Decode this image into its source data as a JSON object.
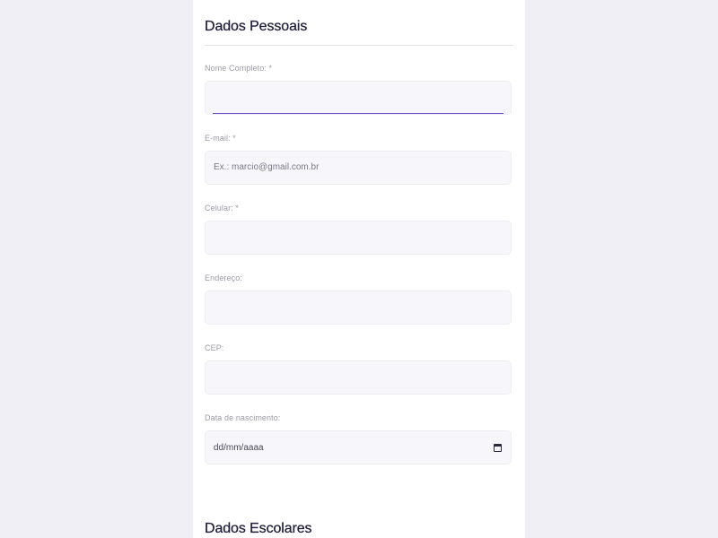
{
  "personal": {
    "title": "Dados Pessoais",
    "fields": {
      "full_name": {
        "label": "Nome Completo: *",
        "value": ""
      },
      "email": {
        "label": "E-mail: *",
        "placeholder": "Ex.: marcio@gmail.com.br"
      },
      "phone": {
        "label": "Celular: *",
        "value": ""
      },
      "address": {
        "label": "Endereço:",
        "value": ""
      },
      "cep": {
        "label": "CEP:",
        "value": ""
      },
      "birth_date": {
        "label": "Data de nascimento:",
        "value": "dd/mm/aaaa",
        "icon": "calendar-icon"
      }
    }
  },
  "school": {
    "title": "Dados Escolares"
  },
  "colors": {
    "page_background": "#efeff5",
    "card_background": "#ffffff",
    "input_background": "#f7f7fb",
    "focus_accent": "#6d4bc3",
    "title_text": "#1f1d3a"
  }
}
